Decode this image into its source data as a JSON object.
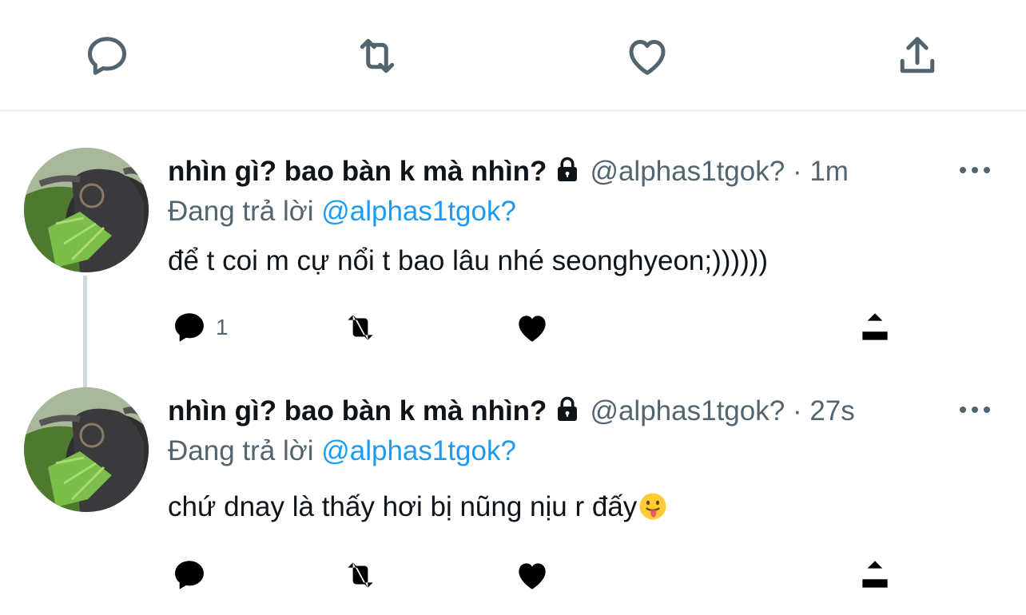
{
  "top_actions": {
    "icons": [
      "reply-icon",
      "retweet-icon",
      "like-icon",
      "share-icon"
    ]
  },
  "tweets": [
    {
      "name": "nhìn gì? bao bàn k mà nhìn?",
      "handle": "@alphas1tgok?",
      "separator": "·",
      "time": "1m",
      "reply_prefix": "Đang trả lời",
      "reply_mention": "@alphas1tgok?",
      "text": "để t coi m cự nổi t bao lâu nhé seonghyeon;))))))",
      "reply_count": "1"
    },
    {
      "name": "nhìn gì? bao bàn k mà nhìn?",
      "handle": "@alphas1tgok?",
      "separator": "·",
      "time": "27s",
      "reply_prefix": "Đang trả lời",
      "reply_mention": "@alphas1tgok?",
      "text": "chứ dnay là thấy hơi bị nũng nịu r đấy",
      "reply_count": ""
    }
  ],
  "colors": {
    "icon_gray": "#536471",
    "mention_blue": "#1d9bf0",
    "divider": "#eff3f4"
  }
}
